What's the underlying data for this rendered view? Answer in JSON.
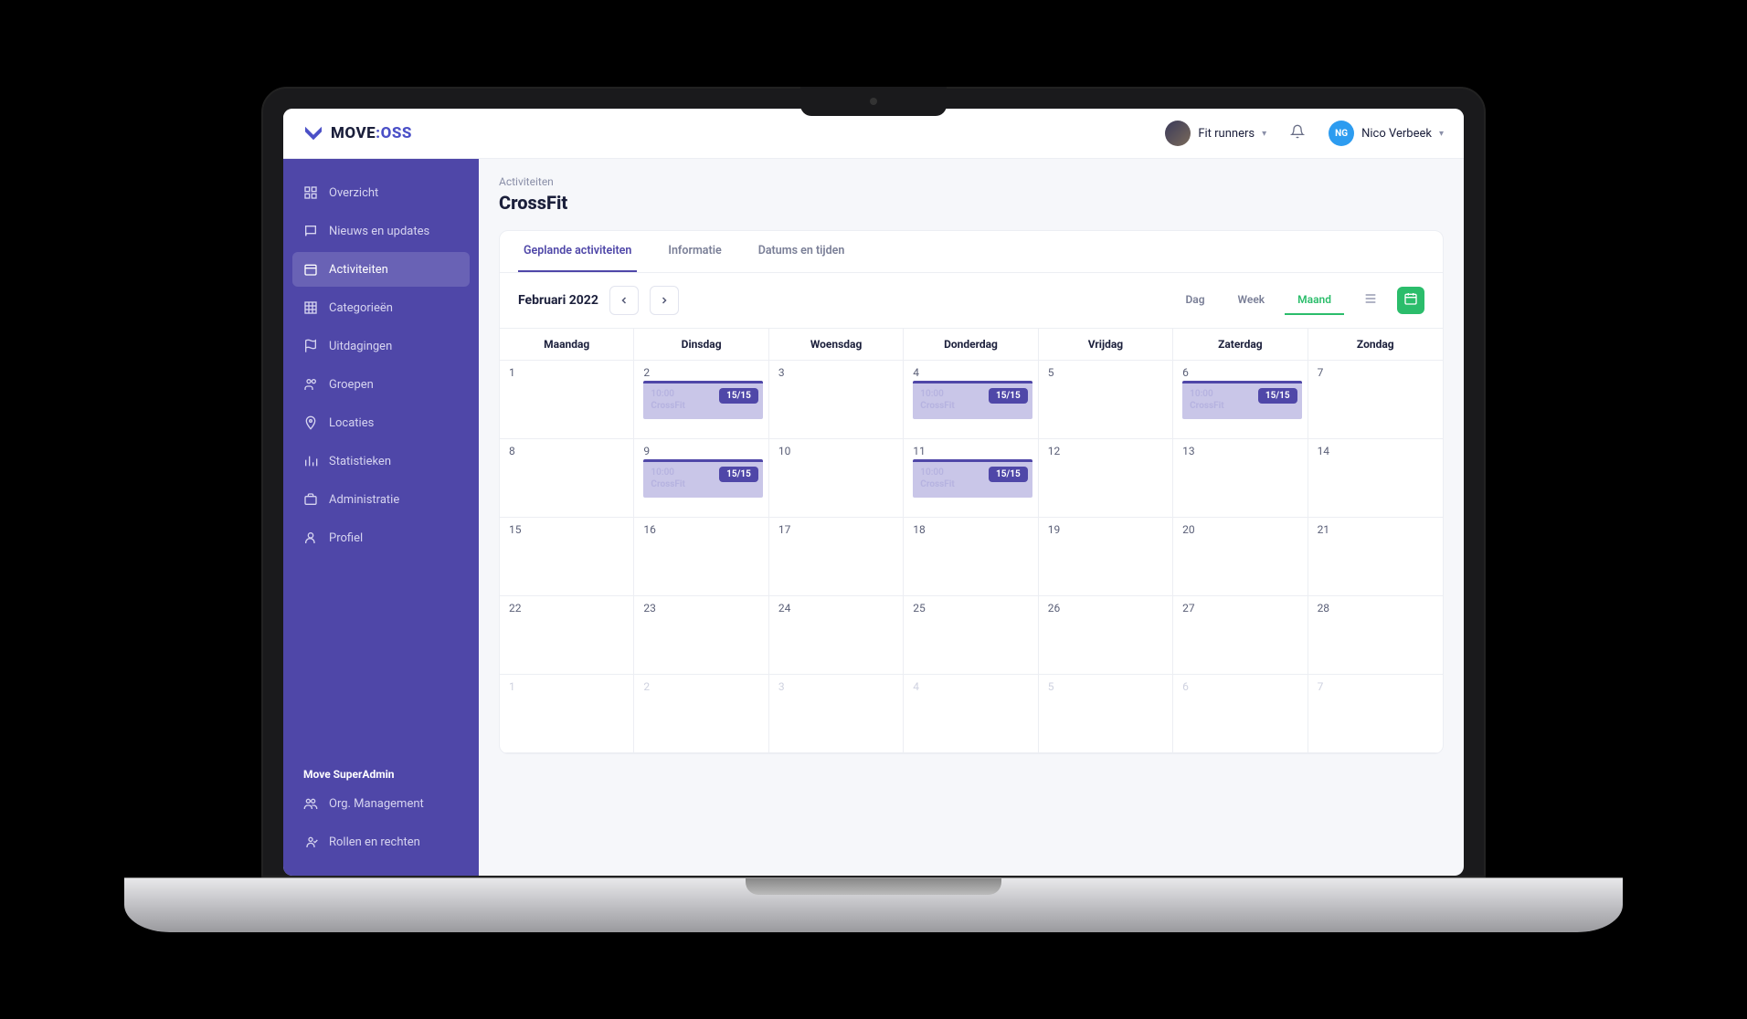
{
  "logo": {
    "part1": "MOVE",
    "part2": "OSS"
  },
  "header": {
    "org_name": "Fit runners",
    "user_name": "Nico Verbeek",
    "user_initials": "NG"
  },
  "sidebar": {
    "items": [
      {
        "label": "Overzicht"
      },
      {
        "label": "Nieuws en updates"
      },
      {
        "label": "Activiteiten",
        "active": true
      },
      {
        "label": "Categorieën"
      },
      {
        "label": "Uitdagingen"
      },
      {
        "label": "Groepen"
      },
      {
        "label": "Locaties"
      },
      {
        "label": "Statistieken"
      },
      {
        "label": "Administratie"
      },
      {
        "label": "Profiel"
      }
    ],
    "admin_section_label": "Move SuperAdmin",
    "admin_items": [
      {
        "label": "Org. Management"
      },
      {
        "label": "Rollen en rechten"
      }
    ]
  },
  "page": {
    "breadcrumb": "Activiteiten",
    "title": "CrossFit"
  },
  "tabs": [
    {
      "label": "Geplande activiteiten",
      "active": true
    },
    {
      "label": "Informatie"
    },
    {
      "label": "Datums en tijden"
    }
  ],
  "calendar": {
    "month_label": "Februari 2022",
    "view_modes": [
      {
        "label": "Dag"
      },
      {
        "label": "Week"
      },
      {
        "label": "Maand",
        "active": true
      }
    ],
    "day_headers": [
      "Maandag",
      "Dinsdag",
      "Woensdag",
      "Donderdag",
      "Vrijdag",
      "Zaterdag",
      "Zondag"
    ],
    "event_time": "10:00",
    "event_name": "CrossFit",
    "event_badge": "15/15",
    "cells": [
      {
        "n": "1"
      },
      {
        "n": "2",
        "event": true
      },
      {
        "n": "3"
      },
      {
        "n": "4",
        "event": true
      },
      {
        "n": "5"
      },
      {
        "n": "6",
        "event": true
      },
      {
        "n": "7"
      },
      {
        "n": "8"
      },
      {
        "n": "9",
        "event": true
      },
      {
        "n": "10"
      },
      {
        "n": "11",
        "event": true
      },
      {
        "n": "12"
      },
      {
        "n": "13"
      },
      {
        "n": "14"
      },
      {
        "n": "15"
      },
      {
        "n": "16"
      },
      {
        "n": "17"
      },
      {
        "n": "18"
      },
      {
        "n": "19"
      },
      {
        "n": "20"
      },
      {
        "n": "21"
      },
      {
        "n": "22"
      },
      {
        "n": "23"
      },
      {
        "n": "24"
      },
      {
        "n": "25"
      },
      {
        "n": "26"
      },
      {
        "n": "27"
      },
      {
        "n": "28"
      },
      {
        "n": "1",
        "out": true
      },
      {
        "n": "2",
        "out": true
      },
      {
        "n": "3",
        "out": true
      },
      {
        "n": "4",
        "out": true
      },
      {
        "n": "5",
        "out": true
      },
      {
        "n": "6",
        "out": true
      },
      {
        "n": "7",
        "out": true
      }
    ]
  }
}
